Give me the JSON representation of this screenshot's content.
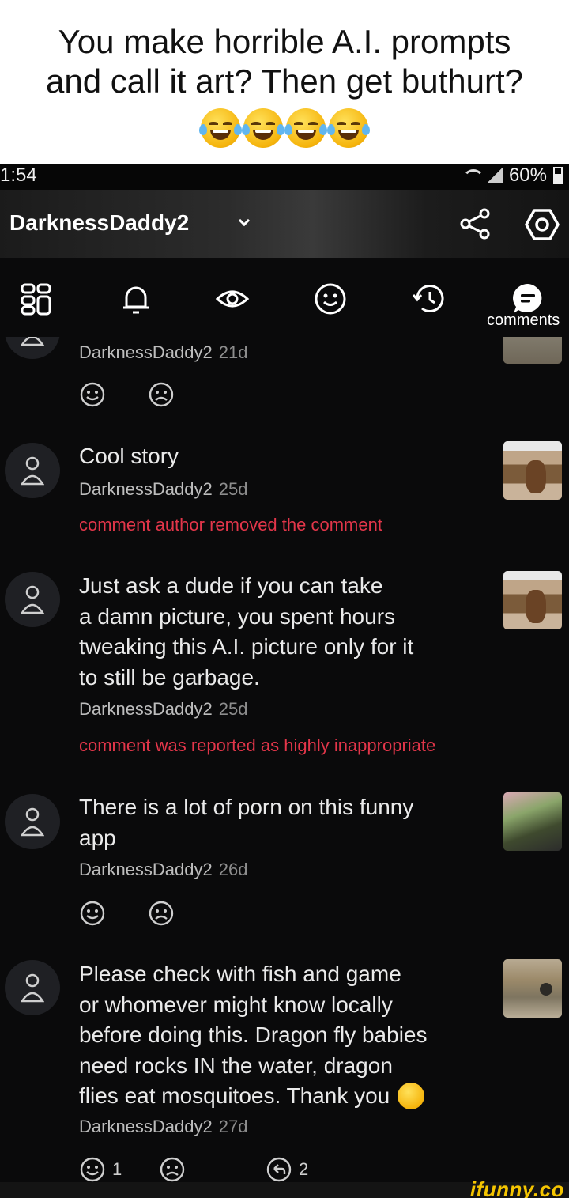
{
  "caption": {
    "line1": "You make horrible A.I. prompts",
    "line2": "and call it art? Then get buthurt?",
    "emojis": [
      "rolling-on-floor-laughing",
      "tears-of-joy",
      "rolling-on-floor-laughing",
      "tears-of-joy"
    ]
  },
  "status_bar": {
    "time": "1:54",
    "battery": "60%"
  },
  "profile": {
    "username": "DarknessDaddy2"
  },
  "tabs": {
    "active": "comments",
    "active_label": "comments",
    "items": [
      "grid-icon",
      "bell-icon",
      "eye-icon",
      "smiley-icon",
      "history-icon",
      "comment-bubble-icon"
    ]
  },
  "feed": {
    "partial_item": {
      "author": "DarknessDaddy2",
      "ago": "21d"
    },
    "comments": [
      {
        "text": "Cool story",
        "author": "DarknessDaddy2",
        "ago": "25d",
        "notice": "comment author removed the comment"
      },
      {
        "text_lines": [
          "Just ask a dude if you can take",
          "a damn picture, you spent hours",
          "tweaking this A.I. picture only for it",
          "to still be garbage."
        ],
        "author": "DarknessDaddy2",
        "ago": "25d",
        "notice": "comment was reported as highly inappropriate"
      },
      {
        "text_lines": [
          "There is a lot of porn on this funny",
          "app"
        ],
        "author": "DarknessDaddy2",
        "ago": "26d"
      },
      {
        "text_lines": [
          "Please check with fish and game",
          "or whomever might know locally",
          "before doing this. Dragon fly babies",
          "need rocks IN the water, dragon",
          "flies eat mosquitoes. Thank you"
        ],
        "author": "DarknessDaddy2",
        "ago": "27d",
        "likes": "1",
        "replies": "2"
      }
    ]
  },
  "watermark": "ifunny.co",
  "colors": {
    "background": "#0a0a0b",
    "notice_red": "#e3364a",
    "watermark_yellow": "#f5c500"
  }
}
